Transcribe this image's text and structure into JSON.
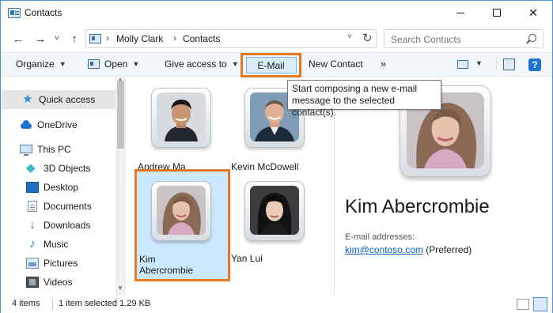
{
  "window": {
    "title": "Contacts",
    "buttons": {
      "minimize": "minimize",
      "maximize": "maximize",
      "close": "✕"
    }
  },
  "nav": {
    "back": "←",
    "forward": "→",
    "recent": "˅",
    "up": "↑"
  },
  "address": {
    "crumbs": [
      "Molly Clark",
      "Contacts"
    ],
    "separator": "›"
  },
  "search": {
    "placeholder": "Search Contacts"
  },
  "commands": {
    "organize": "Organize",
    "open": "Open",
    "give_access": "Give access to",
    "email": "E-Mail",
    "new_contact": "New Contact",
    "more": "»"
  },
  "tooltip": {
    "text": "Start composing a new e-mail message to the selected contact(s)."
  },
  "sidebar": {
    "items": [
      {
        "label": "Quick access",
        "icon": "star-icon",
        "selected": true
      },
      {
        "label": "OneDrive",
        "icon": "cloud-icon"
      },
      {
        "label": "This PC",
        "icon": "computer-icon"
      },
      {
        "label": "3D Objects",
        "icon": "cube-icon"
      },
      {
        "label": "Desktop",
        "icon": "desktop-icon"
      },
      {
        "label": "Documents",
        "icon": "document-icon"
      },
      {
        "label": "Downloads",
        "icon": "download-icon"
      },
      {
        "label": "Music",
        "icon": "music-icon"
      },
      {
        "label": "Pictures",
        "icon": "pictures-icon"
      },
      {
        "label": "Videos",
        "icon": "video-icon"
      }
    ]
  },
  "contacts": [
    {
      "name": "Andrew Ma"
    },
    {
      "name": "Kevin McDowell"
    },
    {
      "name_line1": "Kim",
      "name_line2": "Abercrombie",
      "selected": true
    },
    {
      "name": "Yan Lui"
    }
  ],
  "preview": {
    "name": "Kim Abercrombie",
    "email_label": "E-mail addresses:",
    "email": "kim@contoso.com",
    "email_suffix": "(Preferred)"
  },
  "status": {
    "count": "4 items",
    "selection": "1 item selected  1.29 KB"
  },
  "colors": {
    "highlight": "#e8771f",
    "selection": "#cce8ff",
    "accent": "#0563c1"
  }
}
